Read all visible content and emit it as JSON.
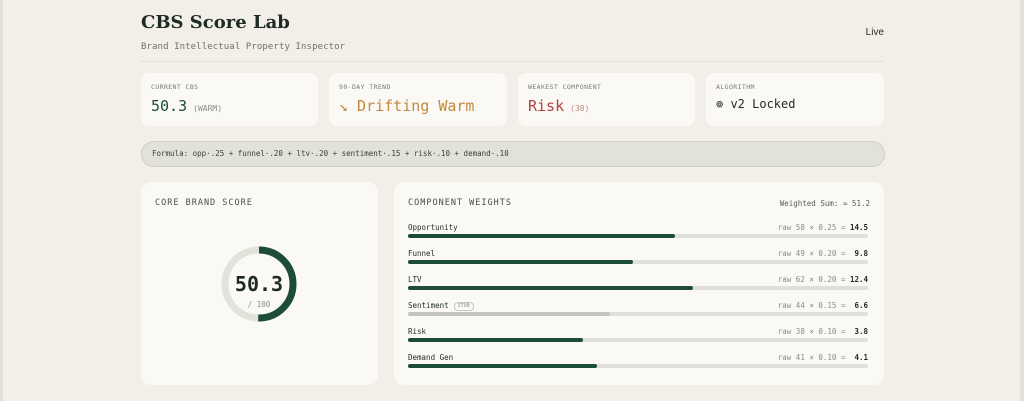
{
  "header": {
    "title": "CBS Score Lab",
    "subtitle": "Brand Intellectual Property Inspector",
    "status": "Live"
  },
  "stats": [
    {
      "label": "CURRENT CBS",
      "value": "50.3",
      "note": "(WARM)"
    },
    {
      "label": "90-DAY TREND",
      "icon": "trend-down-icon",
      "value": "↘ Drifting Warm"
    },
    {
      "label": "WEAKEST COMPONENT",
      "value": "Risk",
      "note": "(38)"
    },
    {
      "label": "ALGORITHM",
      "icon": "lock-icon",
      "value": "⊚ v2 Locked"
    }
  ],
  "formula": "Formula: opp·.25 + funnel·.20 + ltv·.20 + sentiment·.15 + risk·.10 + demand·.10",
  "score_card": {
    "label": "CORE BRAND SCORE",
    "score": "50.3",
    "denominator": "/ 100",
    "score_fraction": 0.503
  },
  "weights_card": {
    "label": "COMPONENT WEIGHTS",
    "weighted_sum": "Weighted Sum: ≈ 51.2",
    "components": [
      {
        "name": "Opportunity",
        "raw": "raw 58",
        "weight": "0.25",
        "result": "14.5",
        "value": 58,
        "stale": false
      },
      {
        "name": "Funnel",
        "raw": "raw 49",
        "weight": "0.20",
        "result": "9.8",
        "value": 49,
        "stale": false
      },
      {
        "name": "LTV",
        "raw": "raw 62",
        "weight": "0.20",
        "result": "12.4",
        "value": 62,
        "stale": false
      },
      {
        "name": "Sentiment",
        "badge": "STUB",
        "raw": "raw 44",
        "weight": "0.15",
        "result": "6.6",
        "value": 44,
        "stale": true
      },
      {
        "name": "Risk",
        "raw": "raw 38",
        "weight": "0.10",
        "result": "3.8",
        "value": 38,
        "stale": false
      },
      {
        "name": "Demand Gen",
        "raw": "raw 41",
        "weight": "0.10",
        "result": "4.1",
        "value": 41,
        "stale": false
      }
    ]
  },
  "colors": {
    "accent": "#1d4d36",
    "warning": "#c3893b",
    "danger": "#b3413a",
    "stale_bar": "#c4c4bd"
  }
}
